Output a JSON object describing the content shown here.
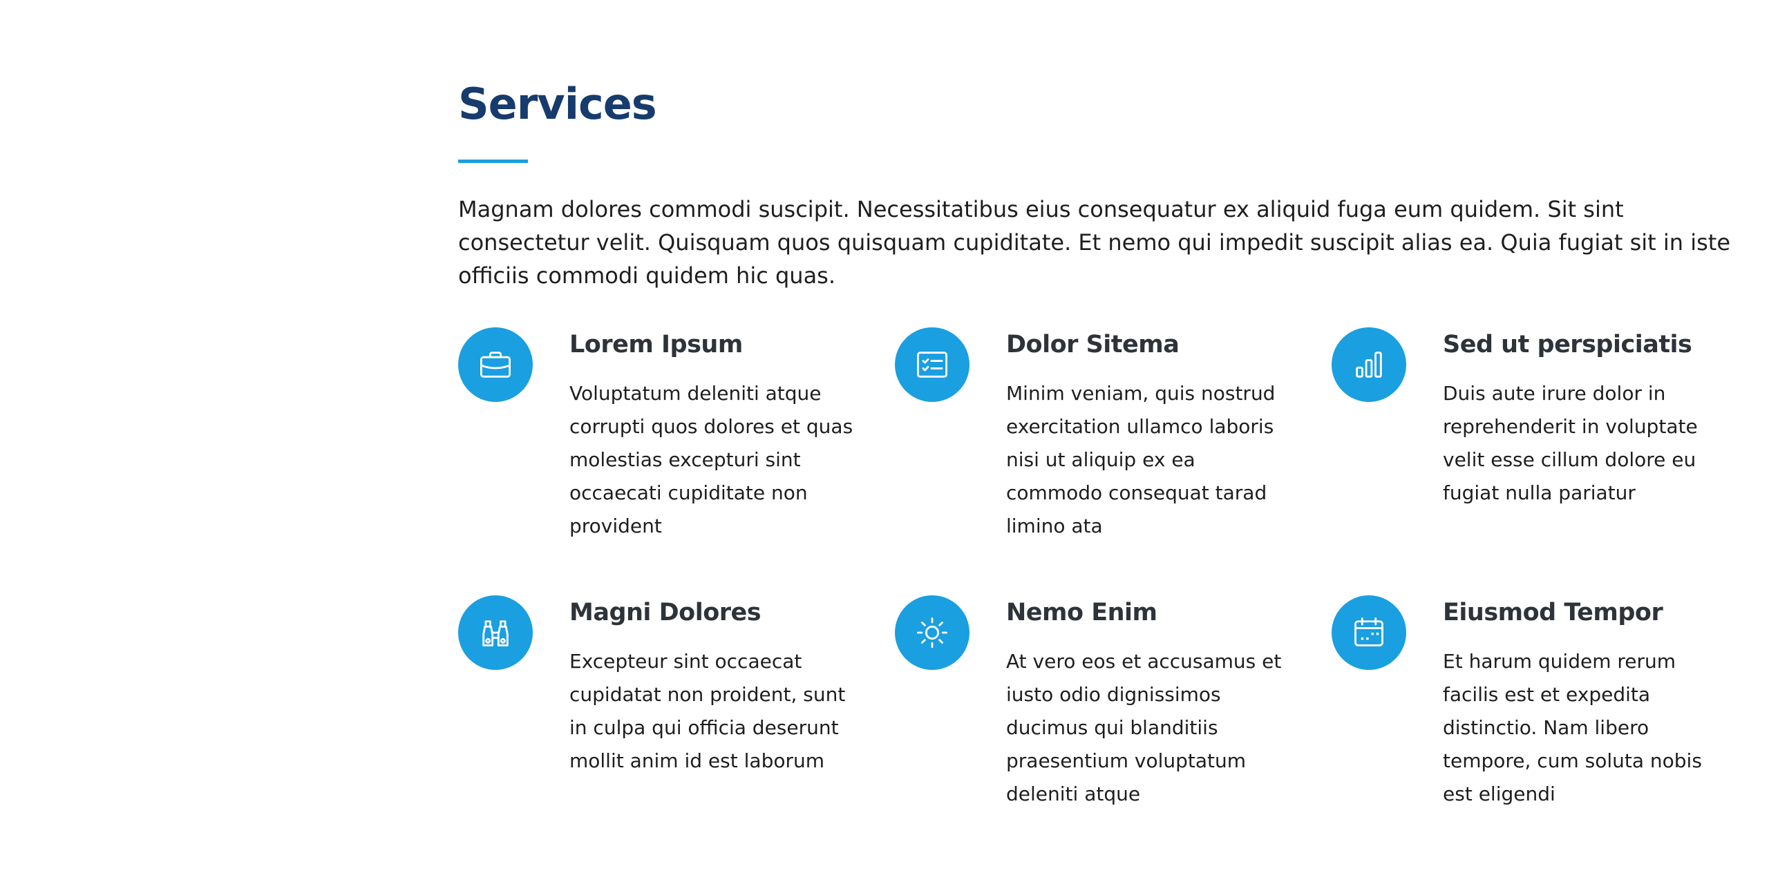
{
  "section": {
    "title": "Services",
    "intro": "Magnam dolores commodi suscipit. Necessitatibus eius consequatur ex aliquid fuga eum quidem. Sit sint consectetur velit. Quisquam quos quisquam cupiditate. Et nemo qui impedit suscipit alias ea. Quia fugiat sit in iste officiis commodi quidem hic quas."
  },
  "colors": {
    "accent": "#1a9fe0",
    "title": "#173b6c",
    "heading": "#2e333a"
  },
  "services": [
    {
      "icon": "briefcase-icon",
      "title": "Lorem Ipsum",
      "text": "Voluptatum deleniti atque corrupti quos dolores et quas molestias excepturi sint occaecati cupiditate non provident"
    },
    {
      "icon": "checklist-card-icon",
      "title": "Dolor Sitema",
      "text": "Minim veniam, quis nostrud exercitation ullamco laboris nisi ut aliquip ex ea commodo consequat tarad limino ata"
    },
    {
      "icon": "bar-chart-icon",
      "title": "Sed ut perspiciatis",
      "text": "Duis aute irure dolor in reprehenderit in voluptate velit esse cillum dolore eu fugiat nulla pariatur"
    },
    {
      "icon": "binoculars-icon",
      "title": "Magni Dolores",
      "text": "Excepteur sint occaecat cupidatat non proident, sunt in culpa qui officia deserunt mollit anim id est laborum"
    },
    {
      "icon": "sun-icon",
      "title": "Nemo Enim",
      "text": "At vero eos et accusamus et iusto odio dignissimos ducimus qui blanditiis praesentium voluptatum deleniti atque"
    },
    {
      "icon": "calendar-icon",
      "title": "Eiusmod Tempor",
      "text": "Et harum quidem rerum facilis est et expedita distinctio. Nam libero tempore, cum soluta nobis est eligendi"
    }
  ]
}
